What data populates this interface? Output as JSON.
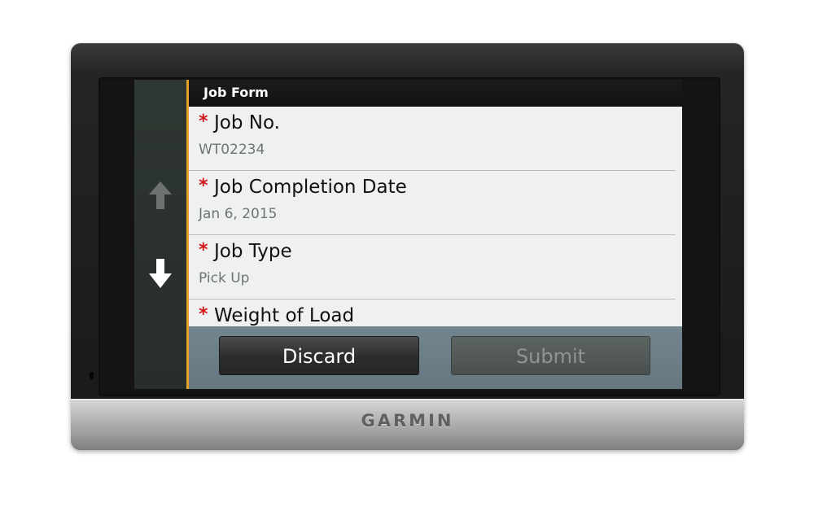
{
  "device": {
    "brand": "GARMIN"
  },
  "screen": {
    "title": "Job Form",
    "nav": {
      "up_icon": "arrow-up-icon",
      "down_icon": "arrow-down-icon"
    },
    "fields": [
      {
        "required_mark": "*",
        "label": "Job No.",
        "value": "WT02234"
      },
      {
        "required_mark": "*",
        "label": "Job Completion Date",
        "value": "Jan 6, 2015"
      },
      {
        "required_mark": "*",
        "label": "Job Type",
        "value": "Pick Up"
      },
      {
        "required_mark": "*",
        "label": "Weight of Load",
        "value": ""
      }
    ],
    "actions": {
      "discard_label": "Discard",
      "submit_label": "Submit"
    }
  },
  "colors": {
    "accent": "#e3a22a",
    "required": "#d3161b",
    "action_bar": "#6b7d86"
  }
}
